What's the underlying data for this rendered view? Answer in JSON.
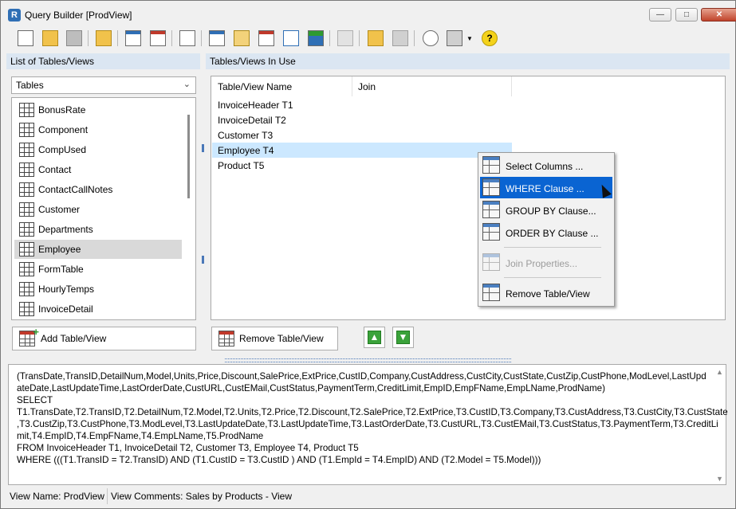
{
  "window": {
    "title": "Query Builder [ProdView]",
    "controls": {
      "minimize": "—",
      "maximize": "□",
      "close": "✕"
    }
  },
  "toolbar": {
    "buttons": [
      {
        "name": "new-icon"
      },
      {
        "name": "open-icon"
      },
      {
        "name": "save-icon"
      },
      {
        "name": "folder-icon"
      },
      {
        "name": "add-table-icon"
      },
      {
        "name": "remove-table-icon"
      },
      {
        "name": "copy-icon"
      },
      {
        "name": "joins-icon"
      },
      {
        "name": "select-columns-icon"
      },
      {
        "name": "where-icon"
      },
      {
        "name": "group-by-icon"
      },
      {
        "name": "order-by-icon"
      },
      {
        "name": "join-properties-icon"
      },
      {
        "name": "add-item-icon"
      },
      {
        "name": "delete-item-icon"
      },
      {
        "name": "preview-icon"
      },
      {
        "name": "print-icon"
      },
      {
        "name": "help-icon"
      }
    ]
  },
  "left_panel": {
    "header": "List of Tables/Views",
    "dropdown_value": "Tables",
    "items": [
      {
        "label": "BonusRate",
        "selected": false
      },
      {
        "label": "Component",
        "selected": false
      },
      {
        "label": "CompUsed",
        "selected": false
      },
      {
        "label": "Contact",
        "selected": false
      },
      {
        "label": "ContactCallNotes",
        "selected": false
      },
      {
        "label": "Customer",
        "selected": false
      },
      {
        "label": "Departments",
        "selected": false
      },
      {
        "label": "Employee",
        "selected": true
      },
      {
        "label": "FormTable",
        "selected": false
      },
      {
        "label": "HourlyTemps",
        "selected": false
      },
      {
        "label": "InvoiceDetail",
        "selected": false
      }
    ],
    "add_button": "Add Table/View"
  },
  "right_panel": {
    "header": "Tables/Views In Use",
    "columns": [
      "Table/View Name",
      "Join"
    ],
    "rows": [
      {
        "name": "InvoiceHeader T1",
        "selected": false
      },
      {
        "name": "InvoiceDetail T2",
        "selected": false
      },
      {
        "name": "Customer T3",
        "selected": false
      },
      {
        "name": "Employee T4",
        "selected": true
      },
      {
        "name": "Product T5",
        "selected": false
      }
    ],
    "remove_button": "Remove Table/View",
    "move_up": "▲",
    "move_down": "▼"
  },
  "context_menu": {
    "items": [
      {
        "label": "Select Columns ...",
        "icon": "select-columns-icon",
        "highlighted": false,
        "disabled": false
      },
      {
        "label": "WHERE Clause ...",
        "icon": "where-clause-icon",
        "highlighted": true,
        "disabled": false
      },
      {
        "label": "GROUP BY Clause...",
        "icon": "group-by-icon",
        "highlighted": false,
        "disabled": false
      },
      {
        "label": "ORDER BY Clause ...",
        "icon": "order-by-icon",
        "highlighted": false,
        "disabled": false
      },
      {
        "label": "Join Properties...",
        "icon": "join-properties-icon",
        "highlighted": false,
        "disabled": true
      },
      {
        "label": "Remove Table/View",
        "icon": "remove-table-icon",
        "highlighted": false,
        "disabled": false
      }
    ]
  },
  "sql": {
    "lines": [
      "(TransDate,TransID,DetailNum,Model,Units,Price,Discount,SalePrice,ExtPrice,CustID,Company,CustAddress,CustCity,CustState,CustZip,CustPhone,ModLevel,LastUpd",
      "ateDate,LastUpdateTime,LastOrderDate,CustURL,CustEMail,CustStatus,PaymentTerm,CreditLimit,EmpID,EmpFName,EmpLName,ProdName)",
      "SELECT",
      "T1.TransDate,T2.TransID,T2.DetailNum,T2.Model,T2.Units,T2.Price,T2.Discount,T2.SalePrice,T2.ExtPrice,T3.CustID,T3.Company,T3.CustAddress,T3.CustCity,T3.CustState",
      ",T3.CustZip,T3.CustPhone,T3.ModLevel,T3.LastUpdateDate,T3.LastUpdateTime,T3.LastOrderDate,T3.CustURL,T3.CustEMail,T3.CustStatus,T3.PaymentTerm,T3.CreditLi",
      "mit,T4.EmpID,T4.EmpFName,T4.EmpLName,T5.ProdName",
      "FROM  InvoiceHeader T1, InvoiceDetail T2, Customer T3, Employee T4, Product T5",
      "WHERE  (((T1.TransID = T2.TransID) AND (T1.CustID = T3.CustID ) AND  (T1.EmpId = T4.EmpID) AND (T2.Model = T5.Model)))"
    ]
  },
  "status": {
    "view_name": "View Name: ProdView",
    "view_comments": "View Comments: Sales by Products - View"
  },
  "colors": {
    "header_bg": "#dbe6f2",
    "menu_highlight": "#0a64d2",
    "row_selected": "#cce8ff",
    "list_selected": "#d9d9d9"
  }
}
